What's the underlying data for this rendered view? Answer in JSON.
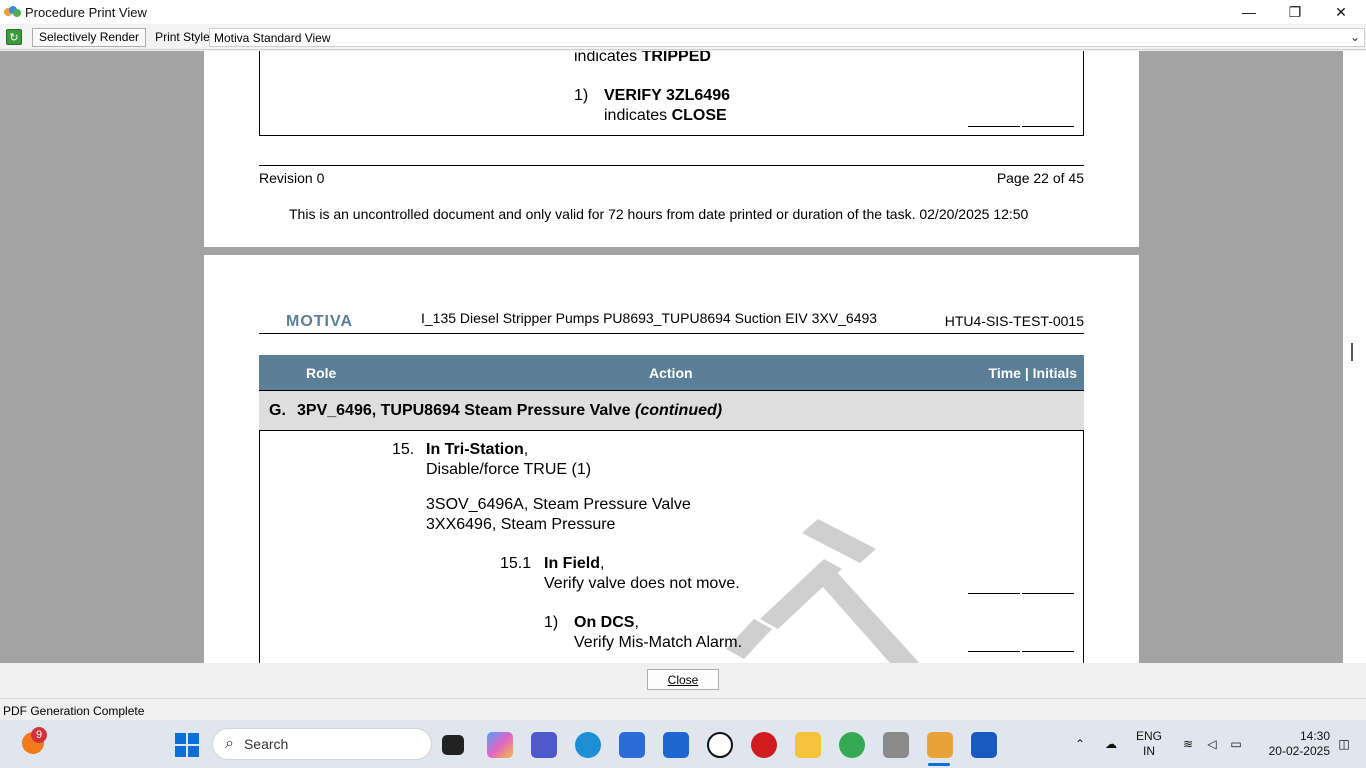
{
  "window": {
    "title": "Procedure Print View",
    "minimize": "—",
    "maximize": "❐",
    "close": "✕"
  },
  "toolbar": {
    "selectively_render": "Selectively Render",
    "print_style_label": "Print Style:",
    "print_style_value": "Motiva Standard View"
  },
  "page1": {
    "line_tripped_pre": "indicates ",
    "line_tripped_b": "TRIPPED",
    "step_num": "1)",
    "step_verify": "VERIFY 3ZL6496",
    "line_close_pre": "indicates ",
    "line_close_b": "CLOSE",
    "revision": "Revision 0",
    "page": "Page 22 of 45",
    "disclaimer": "This is an uncontrolled document and only valid for 72 hours from date printed or duration of the task. 02/20/2025 12:50"
  },
  "page2": {
    "logo": "MOTIVA",
    "doc_title": "I_135 Diesel Stripper Pumps PU8693_TUPU8694 Suction EIV 3XV_6493",
    "doc_id": "HTU4-SIS-TEST-0015",
    "headers": {
      "role": "Role",
      "action": "Action",
      "time": "Time | Initials"
    },
    "section": {
      "letter": "G.",
      "title": "3PV_6496, TUPU8694 Steam Pressure Valve ",
      "cont": "(continued)"
    },
    "step15_num": "15.",
    "step15_bold": "In Tri-Station",
    "step15_comma": ",",
    "step15_line2": "Disable/force TRUE (1)",
    "tag1": "3SOV_6496A, Steam Pressure Valve",
    "tag2": "3XX6496, Steam Pressure",
    "step151_num": "15.1",
    "step151_bold": "In Field",
    "step151_comma": ",",
    "step151_line2": "Verify valve does not move.",
    "sub1_num": "1)",
    "sub1_bold": "On DCS",
    "sub1_comma": ",",
    "sub1_line2": "Verify Mis-Match Alarm."
  },
  "close_button": "Close",
  "status": "PDF Generation Complete",
  "taskbar": {
    "search": "Search",
    "notification_count": "9",
    "lang1": "ENG",
    "lang2": "IN",
    "time": "14:30",
    "date": "20-02-2025"
  }
}
